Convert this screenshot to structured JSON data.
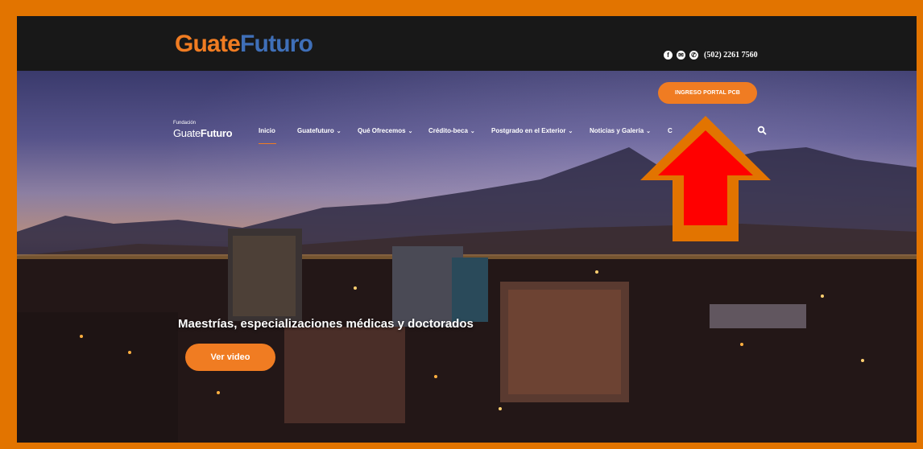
{
  "brand": {
    "part1": "Guate",
    "part2": "Futuro"
  },
  "nav_logo": {
    "fundacion": "Fundación",
    "guate": "Guate",
    "futuro": "Futuro"
  },
  "contact": {
    "phone": "(502) 2261 7560",
    "icons": [
      "facebook-icon",
      "email-icon",
      "phone-icon"
    ]
  },
  "portal_button": "INGRESO PORTAL PCB",
  "nav": {
    "items": [
      {
        "label": "Inicio",
        "dropdown": false
      },
      {
        "label": "Guatefuturo",
        "dropdown": true
      },
      {
        "label": "Qué Ofrecemos",
        "dropdown": true
      },
      {
        "label": "Crédito-beca",
        "dropdown": true
      },
      {
        "label": "Postgrado en el Exterior",
        "dropdown": true
      },
      {
        "label": "Noticias y Galería",
        "dropdown": true
      },
      {
        "label": "C",
        "dropdown": false
      }
    ],
    "chevron": "⌄"
  },
  "hero": {
    "headline": "Maestrías, especializaciones médicas y doctorados",
    "video_button": "Ver video"
  },
  "colors": {
    "accent": "#f07c22",
    "frame": "#e27400",
    "logo_blue": "#3f6fb8",
    "arrow_fill": "#ff0000",
    "arrow_outline": "#e27400"
  }
}
